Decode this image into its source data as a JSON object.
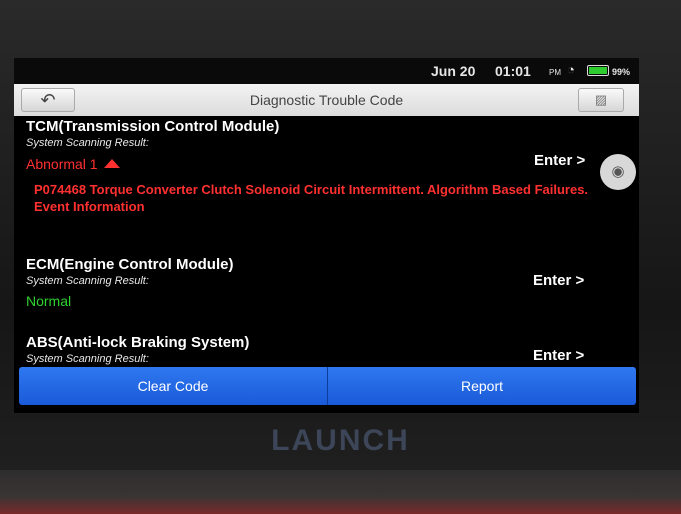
{
  "status": {
    "date": "Jun 20",
    "time": "01:01",
    "ampm": "PM",
    "battery_percent": 99,
    "battery_label": "99%",
    "wifi_icon": "wifi-icon"
  },
  "header": {
    "title": "Diagnostic Trouble Code",
    "back_icon": "back-arrow-icon",
    "exit_icon": "exit-icon"
  },
  "modules": [
    {
      "name": "TCM(Transmission Control Module)",
      "scan_label": "System Scanning Result:",
      "result": "Abnormal 1",
      "result_status": "abnormal",
      "dtc": "P074468 Torque Converter Clutch Solenoid Circuit Intermittent. Algorithm Based Failures. Event Information",
      "enter_label": "Enter >"
    },
    {
      "name": "ECM(Engine Control Module)",
      "scan_label": "System Scanning Result:",
      "result": "Normal",
      "result_status": "normal",
      "enter_label": "Enter >"
    },
    {
      "name": "ABS(Anti-lock Braking System)",
      "scan_label": "System Scanning Result:",
      "enter_label": "Enter >"
    }
  ],
  "footer": {
    "clear_code_label": "Clear Code",
    "report_label": "Report"
  },
  "camera_icon": "camera-icon",
  "brand": "LAUNCH",
  "colors": {
    "abnormal": "#ff3030",
    "normal": "#2fd12f",
    "button_blue": "#1a5ad8"
  }
}
